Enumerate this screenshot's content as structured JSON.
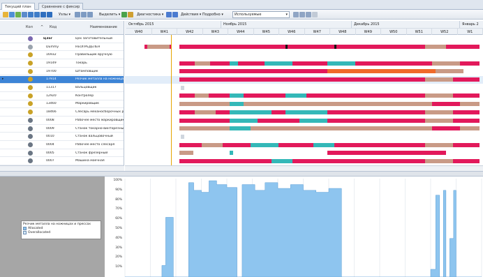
{
  "tabs": [
    {
      "label": "Текущий план",
      "active": true
    },
    {
      "label": "Сравнение с фиксир",
      "active": false
    }
  ],
  "toolbar": {
    "nodes_label": "Узлы",
    "select_label": "Выделить",
    "diag_label": "Диагностика",
    "actions_label": "Действия",
    "details_label": "Подробно",
    "mode_value": "Используемые"
  },
  "grid": {
    "headers": {
      "kol": "Кол",
      "code": "Код",
      "name": "Наименование"
    },
    "rows": [
      {
        "code": "ЦЗаг",
        "name": "Цех заготовительный",
        "icon": "group-icon",
        "color": "#7a68b0",
        "selected": false,
        "bold": true
      },
      {
        "code": "Dummy",
        "name": "НЕОПРЕДЕЛЕН",
        "icon": "resource-icon",
        "color": "#9aa3ad",
        "selected": false
      },
      {
        "code": "16932",
        "name": "Правильщик вручную",
        "icon": "worker-icon",
        "color": "#c9a227",
        "selected": false
      },
      {
        "code": "19149",
        "name": "Токарь",
        "icon": "worker-icon",
        "color": "#c9a227",
        "selected": false
      },
      {
        "code": "19700",
        "name": "Штамповщик",
        "icon": "worker-icon",
        "color": "#c9a227",
        "selected": false
      },
      {
        "code": "17914",
        "name": "Резчик металла на ножницах и прессах",
        "icon": "worker-icon",
        "color": "#c9a227",
        "selected": true
      },
      {
        "code": "11317",
        "name": "Вальцовщик",
        "icon": "worker-icon",
        "color": "#c9a227",
        "selected": false
      },
      {
        "code": "12920",
        "name": "Контролер",
        "icon": "worker-icon",
        "color": "#c9a227",
        "selected": false
      },
      {
        "code": "13460",
        "name": "Маркировщик",
        "icon": "worker-icon",
        "color": "#c9a227",
        "selected": false
      },
      {
        "code": "18466",
        "name": "Слесарь механосборочных работ",
        "icon": "worker-icon",
        "color": "#c9a227",
        "selected": false
      },
      {
        "code": "0008",
        "name": "Рабочее место маркировщика",
        "icon": "machine-icon",
        "color": "#6b7684",
        "selected": false
      },
      {
        "code": "0009",
        "name": "Станок токарно-винторезный",
        "icon": "machine-icon",
        "color": "#6b7684",
        "selected": false
      },
      {
        "code": "0010",
        "name": "Станок вальцовочный",
        "icon": "machine-icon",
        "color": "#6b7684",
        "selected": false
      },
      {
        "code": "0004",
        "name": "Рабочее место слесаря",
        "icon": "machine-icon",
        "color": "#6b7684",
        "selected": false
      },
      {
        "code": "0005",
        "name": "Станок фрезерный",
        "icon": "machine-icon",
        "color": "#6b7684",
        "selected": false
      },
      {
        "code": "0007",
        "name": "Машина моечная",
        "icon": "machine-icon",
        "color": "#6b7684",
        "selected": false
      }
    ]
  },
  "timeline": {
    "months": [
      "Октябрь 2015",
      "Ноябрь 2015",
      "Декабрь 2015",
      "Январь 2"
    ],
    "weeks": [
      "W40",
      "W41",
      "W42",
      "W43",
      "W44",
      "W45",
      "W46",
      "W47",
      "W48",
      "W49",
      "W50",
      "W51",
      "W52",
      "W1"
    ]
  },
  "legend": {
    "title": "Резчик металла на ножницах и прессах",
    "allocated": "Allocated",
    "overallocated": "Overallocated"
  },
  "colors": {
    "bar_main": "#e2195b",
    "bar_tan": "#c99a86",
    "bar_teal": "#34b8b8",
    "bar_orange": "#f06a2a",
    "hist": "#8ec5ef"
  },
  "chart_data": {
    "type": "area",
    "y_ticks": [
      "100%",
      "90%",
      "80%",
      "70%",
      "60%",
      "50%",
      "40%",
      "30%",
      "20%",
      "10%"
    ],
    "ylim": [
      0,
      100
    ],
    "x_unit": "week index",
    "series": [
      {
        "name": "Allocated",
        "points": [
          [
            0,
            0
          ],
          [
            1.45,
            0
          ],
          [
            1.45,
            12
          ],
          [
            1.6,
            12
          ],
          [
            1.6,
            62
          ],
          [
            1.9,
            62
          ],
          [
            1.9,
            0
          ],
          [
            2.5,
            0
          ],
          [
            2.5,
            98
          ],
          [
            2.7,
            98
          ],
          [
            2.7,
            90
          ],
          [
            3.0,
            90
          ],
          [
            3.0,
            88
          ],
          [
            3.3,
            88
          ],
          [
            3.3,
            100
          ],
          [
            3.6,
            100
          ],
          [
            3.6,
            96
          ],
          [
            4.0,
            96
          ],
          [
            4.0,
            93
          ],
          [
            4.4,
            93
          ],
          [
            4.4,
            0
          ],
          [
            4.6,
            0
          ],
          [
            4.6,
            96
          ],
          [
            5.1,
            96
          ],
          [
            5.1,
            90
          ],
          [
            5.5,
            90
          ],
          [
            5.5,
            98
          ],
          [
            6.0,
            98
          ],
          [
            6.0,
            92
          ],
          [
            6.5,
            92
          ],
          [
            6.5,
            96
          ],
          [
            7.0,
            96
          ],
          [
            7.0,
            90
          ],
          [
            7.5,
            90
          ],
          [
            7.5,
            88
          ],
          [
            8.0,
            88
          ],
          [
            8.0,
            92
          ],
          [
            8.5,
            92
          ],
          [
            8.5,
            0
          ],
          [
            12.0,
            0
          ],
          [
            12.0,
            8
          ],
          [
            12.2,
            8
          ],
          [
            12.2,
            85
          ],
          [
            12.35,
            85
          ],
          [
            12.35,
            0
          ],
          [
            12.5,
            0
          ],
          [
            12.5,
            90
          ],
          [
            12.6,
            90
          ],
          [
            12.6,
            0
          ],
          [
            12.75,
            0
          ],
          [
            12.75,
            40
          ],
          [
            12.9,
            40
          ],
          [
            12.9,
            90
          ],
          [
            13.0,
            90
          ],
          [
            13.0,
            0
          ],
          [
            14.0,
            0
          ]
        ]
      }
    ]
  }
}
